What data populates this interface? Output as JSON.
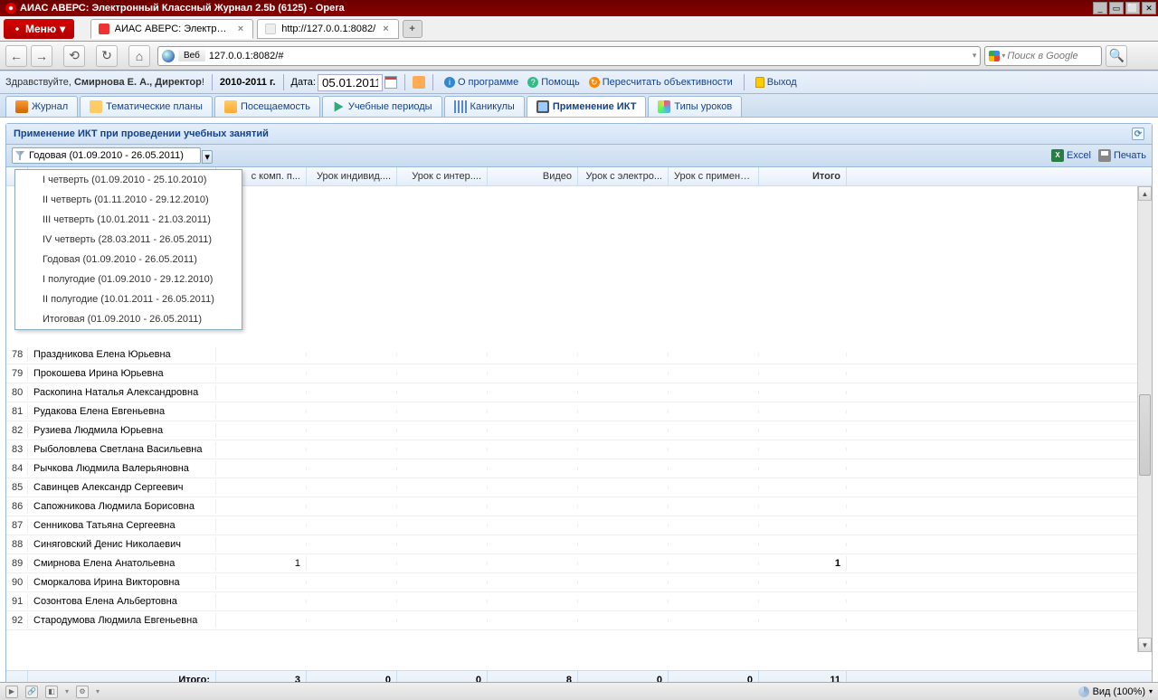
{
  "window": {
    "title": "АИАС АВЕРС: Электронный Классный Журнал 2.5b (6125) - Opera"
  },
  "opera": {
    "menu_label": "Меню",
    "tabs": [
      {
        "label": "АИАС АВЕРС: Электрон...",
        "active": true
      },
      {
        "label": "http://127.0.0.1:8082/",
        "active": false
      }
    ]
  },
  "addrbar": {
    "web_label": "Веб",
    "url": "127.0.0.1:8082/#",
    "search_placeholder": "Поиск в Google"
  },
  "app_toolbar": {
    "greeting_prefix": "Здравствуйте, ",
    "user": "Смирнова Е. А., Директор",
    "year": "2010-2011 г.",
    "date_label": "Дата:",
    "date_value": "05.01.2011",
    "links": {
      "about": "О программе",
      "help": "Помощь",
      "recalc": "Пересчитать объективности",
      "exit": "Выход"
    }
  },
  "tabs": {
    "journal": "Журнал",
    "plans": "Тематические планы",
    "attendance": "Посещаемость",
    "periods": "Учебные периоды",
    "vacation": "Каникулы",
    "ict": "Применение ИКТ",
    "types": "Типы уроков"
  },
  "panel": {
    "title": "Применение ИКТ при проведении учебных занятий",
    "period_selected": "Годовая (01.09.2010 - 26.05.2011)",
    "dropdown": [
      "I четверть (01.09.2010 - 25.10.2010)",
      "II четверть (01.11.2010 - 29.12.2010)",
      "III четверть (10.01.2011 - 21.03.2011)",
      "IV четверть (28.03.2011 - 26.05.2011)",
      "Годовая (01.09.2010 - 26.05.2011)",
      "I полугодие (01.09.2010 - 29.12.2010)",
      "II полугодие (10.01.2011 - 26.05.2011)",
      "Итоговая (01.09.2010 - 26.05.2011)"
    ],
    "excel": "Excel",
    "print": "Печать"
  },
  "grid": {
    "columns": [
      "с комп. п...",
      "Урок индивид....",
      "Урок с интер....",
      "Видео",
      "Урок с электро...",
      "Урок с примене...",
      "Итого"
    ],
    "rows": [
      {
        "n": "78",
        "fio": "Праздникова Елена Юрьевна"
      },
      {
        "n": "79",
        "fio": "Прокошева Ирина Юрьевна"
      },
      {
        "n": "80",
        "fio": "Раскопина Наталья Александровна"
      },
      {
        "n": "81",
        "fio": "Рудакова Елена Евгеньевна"
      },
      {
        "n": "82",
        "fio": "Рузиева Людмила Юрьевна"
      },
      {
        "n": "83",
        "fio": "Рыболовлева Светлана Васильевна"
      },
      {
        "n": "84",
        "fio": "Рычкова Людмила Валерьяновна"
      },
      {
        "n": "85",
        "fio": "Савинцев Александр Сергеевич"
      },
      {
        "n": "86",
        "fio": "Сапожникова Людмила Борисовна"
      },
      {
        "n": "87",
        "fio": "Сенникова Татьяна Сергеевна"
      },
      {
        "n": "88",
        "fio": "Синяговский Денис Николаевич"
      },
      {
        "n": "89",
        "fio": "Смирнова Елена Анатольевна",
        "c0": "1",
        "itogo": "1"
      },
      {
        "n": "90",
        "fio": "Сморкалова Ирина Викторовна"
      },
      {
        "n": "91",
        "fio": "Созонтова Елена Альбертовна"
      },
      {
        "n": "92",
        "fio": "Стародумова Людмила Евгеньевна"
      }
    ],
    "footer": {
      "label": "Итого:",
      "values": [
        "3",
        "0",
        "0",
        "8",
        "0",
        "0",
        "11"
      ]
    }
  },
  "statusbar": {
    "zoom": "Вид (100%)"
  }
}
